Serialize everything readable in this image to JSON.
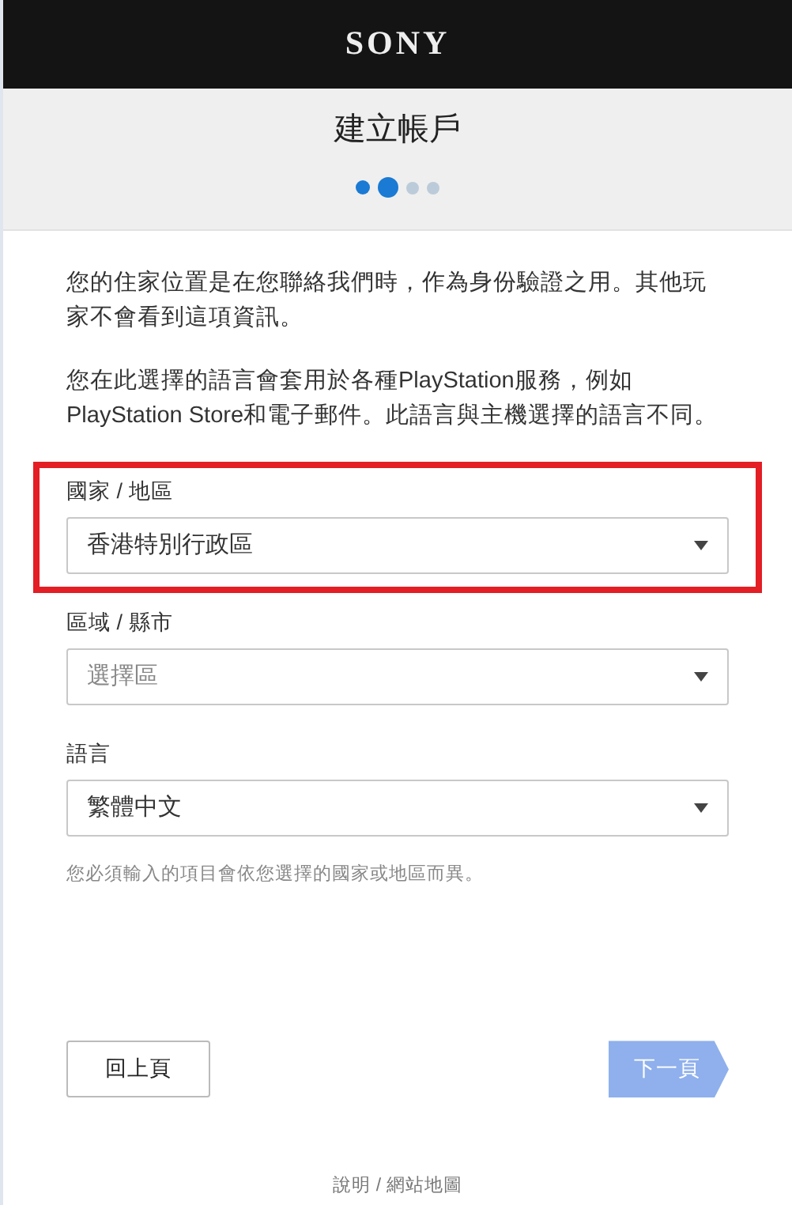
{
  "header": {
    "logo": "SONY"
  },
  "title": "建立帳戶",
  "steps": [
    {
      "completed": true,
      "selected": false
    },
    {
      "completed": true,
      "selected": true
    },
    {
      "completed": false,
      "selected": false
    },
    {
      "completed": false,
      "selected": false
    }
  ],
  "paragraphs": [
    "您的住家位置是在您聯絡我們時，作為身份驗證之用。其他玩家不會看到這項資訊。",
    "您在此選擇的語言會套用於各種PlayStation服務，例如PlayStation Store和電子郵件。此語言與主機選擇的語言不同。"
  ],
  "fields": [
    {
      "label": "國家 / 地區",
      "value": "香港特別行政區",
      "highlighted": true
    },
    {
      "label": "區域 / 縣市",
      "placeholder": "選擇區",
      "highlighted": false
    },
    {
      "label": "語言",
      "value": "繁體中文",
      "highlighted": false
    }
  ],
  "note": "您必須輸入的項目會依您選擇的國家或地區而異。",
  "buttons": {
    "back": {
      "label": "回上頁"
    },
    "next": {
      "label": "下一頁",
      "disabled": true
    }
  },
  "footer": "說明 / 網站地圖"
}
